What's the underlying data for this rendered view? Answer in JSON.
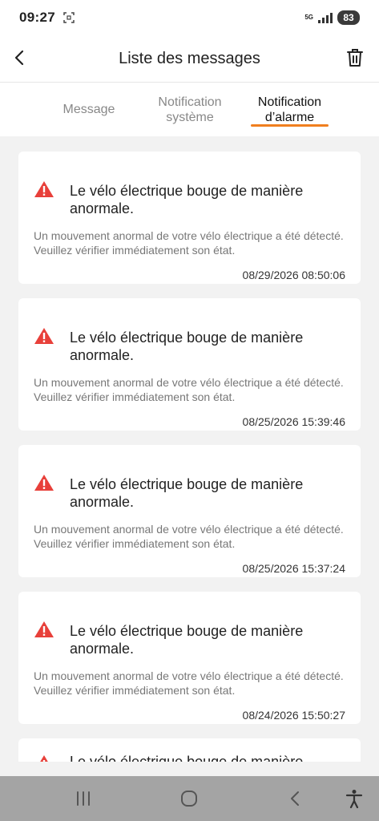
{
  "status_bar": {
    "time": "09:27",
    "network": "5G",
    "battery": "83"
  },
  "header": {
    "title": "Liste des messages",
    "back_icon": "chevron-left-icon",
    "delete_icon": "trash-icon"
  },
  "tabs": [
    {
      "label": "Message",
      "active": false
    },
    {
      "label": "Notification système",
      "active": false
    },
    {
      "label": "Notification d’alarme",
      "active": true
    }
  ],
  "colors": {
    "accent": "#f07f1e",
    "warning": "#e8403a",
    "nav_bar": "#a4a4a4"
  },
  "messages": [
    {
      "title": "Le vélo électrique bouge de manière anormale.",
      "body": "Un mouvement anormal de votre vélo électrique a été détecté. Veuillez vérifier immédiatement son état.",
      "timestamp": "08/29/2026 08:50:06"
    },
    {
      "title": "Le vélo électrique bouge de manière anormale.",
      "body": "Un mouvement anormal de votre vélo électrique a été détecté. Veuillez vérifier immédiatement son état.",
      "timestamp": "08/25/2026 15:39:46"
    },
    {
      "title": "Le vélo électrique bouge de manière anormale.",
      "body": "Un mouvement anormal de votre vélo électrique a été détecté. Veuillez vérifier immédiatement son état.",
      "timestamp": "08/25/2026 15:37:24"
    },
    {
      "title": "Le vélo électrique bouge de manière anormale.",
      "body": "Un mouvement anormal de votre vélo électrique a été détecté. Veuillez vérifier immédiatement son état.",
      "timestamp": "08/24/2026 15:50:27"
    },
    {
      "title": "Le vélo électrique bouge de manière"
    }
  ],
  "nav_bar": {
    "icons": [
      "recent-apps-icon",
      "home-icon",
      "back-icon",
      "accessibility-icon"
    ]
  }
}
